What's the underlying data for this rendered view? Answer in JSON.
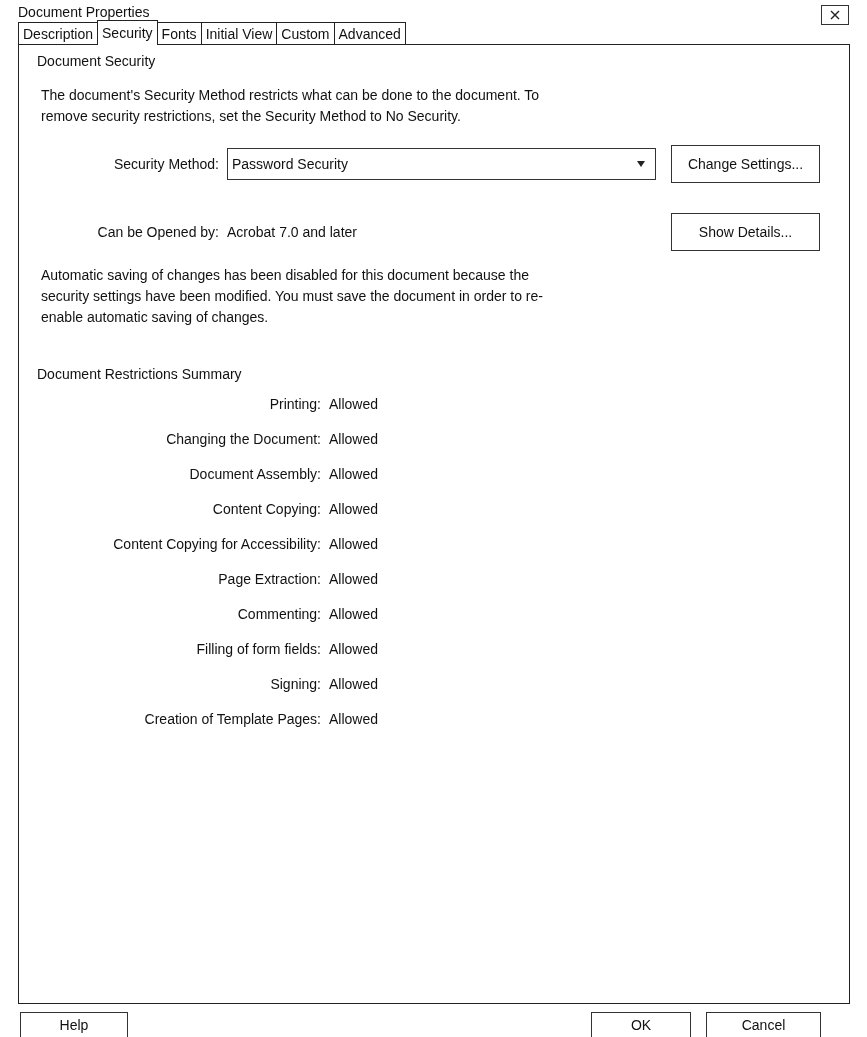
{
  "window": {
    "title": "Document Properties"
  },
  "tabs": [
    {
      "label": "Description",
      "selected": false
    },
    {
      "label": "Security",
      "selected": true
    },
    {
      "label": "Fonts",
      "selected": false
    },
    {
      "label": "Initial View",
      "selected": false
    },
    {
      "label": "Custom",
      "selected": false
    },
    {
      "label": "Advanced",
      "selected": false
    }
  ],
  "security": {
    "heading": "Document Security",
    "intro": "The document's Security Method restricts what can be done to the document. To remove security restrictions, set the Security Method to No Security.",
    "method_label": "Security Method:",
    "method_value": "Password Security",
    "change_button": "Change Settings...",
    "opened_label": "Can be Opened by:",
    "opened_value": "Acrobat 7.0 and later",
    "details_button": "Show Details...",
    "note": "Automatic saving of changes has been disabled for this document because the security settings have been modified. You must save the document in order to re-enable automatic saving of changes."
  },
  "restrictions": {
    "heading": "Document Restrictions Summary",
    "rows": [
      {
        "label": "Printing:",
        "value": "Allowed"
      },
      {
        "label": "Changing the Document:",
        "value": "Allowed"
      },
      {
        "label": "Document Assembly:",
        "value": "Allowed"
      },
      {
        "label": "Content Copying:",
        "value": "Allowed"
      },
      {
        "label": "Content Copying for Accessibility:",
        "value": "Allowed"
      },
      {
        "label": "Page Extraction:",
        "value": "Allowed"
      },
      {
        "label": "Commenting:",
        "value": "Allowed"
      },
      {
        "label": "Filling of form fields:",
        "value": "Allowed"
      },
      {
        "label": "Signing:",
        "value": "Allowed"
      },
      {
        "label": "Creation of Template Pages:",
        "value": "Allowed"
      }
    ]
  },
  "buttons": {
    "help": "Help",
    "ok": "OK",
    "cancel": "Cancel"
  }
}
